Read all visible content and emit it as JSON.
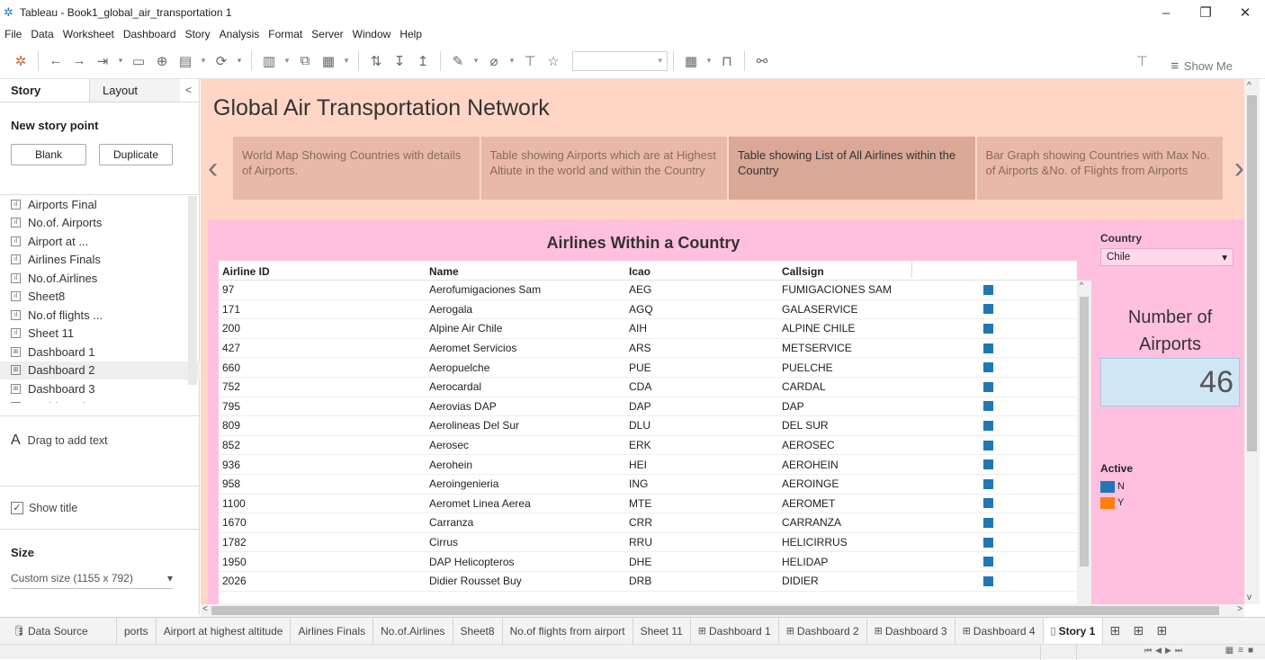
{
  "window": {
    "title": "Tableau - Book1_global_air_transportation 1",
    "controls": [
      "–",
      "❐",
      "✕"
    ]
  },
  "menu": [
    "File",
    "Data",
    "Worksheet",
    "Dashboard",
    "Story",
    "Analysis",
    "Format",
    "Server",
    "Window",
    "Help"
  ],
  "toolbar": {
    "show_me": "Show Me"
  },
  "left_panel": {
    "tabs": [
      "Story",
      "Layout"
    ],
    "new_story_point": "New story point",
    "blank_button": "Blank",
    "duplicate_button": "Duplicate",
    "sheets": [
      {
        "name": "Airports Final",
        "kind": "sheet"
      },
      {
        "name": "No.of. Airports",
        "kind": "sheet"
      },
      {
        "name": "Airport at ...",
        "kind": "sheet"
      },
      {
        "name": "Airlines Finals",
        "kind": "sheet"
      },
      {
        "name": "No.of.Airlines",
        "kind": "sheet"
      },
      {
        "name": "Sheet8",
        "kind": "sheet"
      },
      {
        "name": "No.of flights ...",
        "kind": "sheet"
      },
      {
        "name": "Sheet 11",
        "kind": "sheet"
      },
      {
        "name": "Dashboard 1",
        "kind": "dashboard"
      },
      {
        "name": "Dashboard 2",
        "kind": "dashboard"
      },
      {
        "name": "Dashboard 3",
        "kind": "dashboard"
      },
      {
        "name": "Dashboard 4",
        "kind": "dashboard"
      }
    ],
    "drag_text": "Drag to add text",
    "show_title": "Show title",
    "size_label": "Size",
    "size_value": "Custom size (1155 x 792)"
  },
  "story": {
    "title": "Global Air Transportation Network",
    "points": [
      "World  Map Showing Countries with details of Airports.",
      "Table showing Airports which are at Highest Altiute in the world and within the Country",
      "Table showing List of All Airlines within the Country",
      "Bar Graph showing Countries with Max No. of Airports &No. of Flights from Airports"
    ],
    "active_point": 2
  },
  "dashboard": {
    "chart_title": "Airlines Within a Country",
    "columns": [
      "Airline ID",
      "Name",
      "Icao",
      "Callsign",
      ""
    ],
    "rows": [
      [
        "97",
        "Aerofumigaciones Sam",
        "AEG",
        "FUMIGACIONES SAM"
      ],
      [
        "171",
        "Aerogala",
        "AGQ",
        "GALASERVICE"
      ],
      [
        "200",
        "Alpine Air Chile",
        "AIH",
        "ALPINE CHILE"
      ],
      [
        "427",
        "Aeromet Servicios",
        "ARS",
        "METSERVICE"
      ],
      [
        "660",
        "Aeropuelche",
        "PUE",
        "PUELCHE"
      ],
      [
        "752",
        "Aerocardal",
        "CDA",
        "CARDAL"
      ],
      [
        "795",
        "Aerovias DAP",
        "DAP",
        "DAP"
      ],
      [
        "809",
        "Aerolineas Del Sur",
        "DLU",
        "DEL SUR"
      ],
      [
        "852",
        "Aerosec",
        "ERK",
        "AEROSEC"
      ],
      [
        "936",
        "Aerohein",
        "HEI",
        "AEROHEIN"
      ],
      [
        "958",
        "Aeroingenieria",
        "ING",
        "AEROINGE"
      ],
      [
        "1100",
        "Aeromet Linea Aerea",
        "MTE",
        "AEROMET"
      ],
      [
        "1670",
        "Carranza",
        "CRR",
        "CARRANZA"
      ],
      [
        "1782",
        "Cirrus",
        "RRU",
        "HELICIRRUS"
      ],
      [
        "1950",
        "DAP Helicopteros",
        "DHE",
        "HELIDAP"
      ],
      [
        "2026",
        "Didier Rousset Buy",
        "DRB",
        "DIDIER"
      ]
    ],
    "country_label": "Country",
    "country_value": "Chile",
    "kpi_title": "Number of Airports",
    "kpi_value": "46",
    "legend_title": "Active",
    "legend_items": [
      {
        "label": "N",
        "color": "#1f77b4"
      },
      {
        "label": "Y",
        "color": "#ff7f0e"
      }
    ]
  },
  "sheet_tabs": [
    {
      "label": "Data Source",
      "glyph": "🛢"
    },
    {
      "label": "ports",
      "glyph": ""
    },
    {
      "label": "Airport at highest altitude",
      "glyph": ""
    },
    {
      "label": "Airlines Finals",
      "glyph": ""
    },
    {
      "label": "No.of.Airlines",
      "glyph": ""
    },
    {
      "label": "Sheet8",
      "glyph": ""
    },
    {
      "label": "No.of flights from airport",
      "glyph": ""
    },
    {
      "label": "Sheet 11",
      "glyph": ""
    },
    {
      "label": "Dashboard 1",
      "glyph": "⊞"
    },
    {
      "label": "Dashboard 2",
      "glyph": "⊞"
    },
    {
      "label": "Dashboard 3",
      "glyph": "⊞"
    },
    {
      "label": "Dashboard 4",
      "glyph": "⊞"
    },
    {
      "label": "Story 1",
      "glyph": "▯"
    }
  ],
  "colors": {
    "story_bg": "#ffd6c6",
    "dashboard_bg": "#ffc0e0",
    "mark": "#1f77b4",
    "kpi_bg": "#cfe6f5"
  }
}
